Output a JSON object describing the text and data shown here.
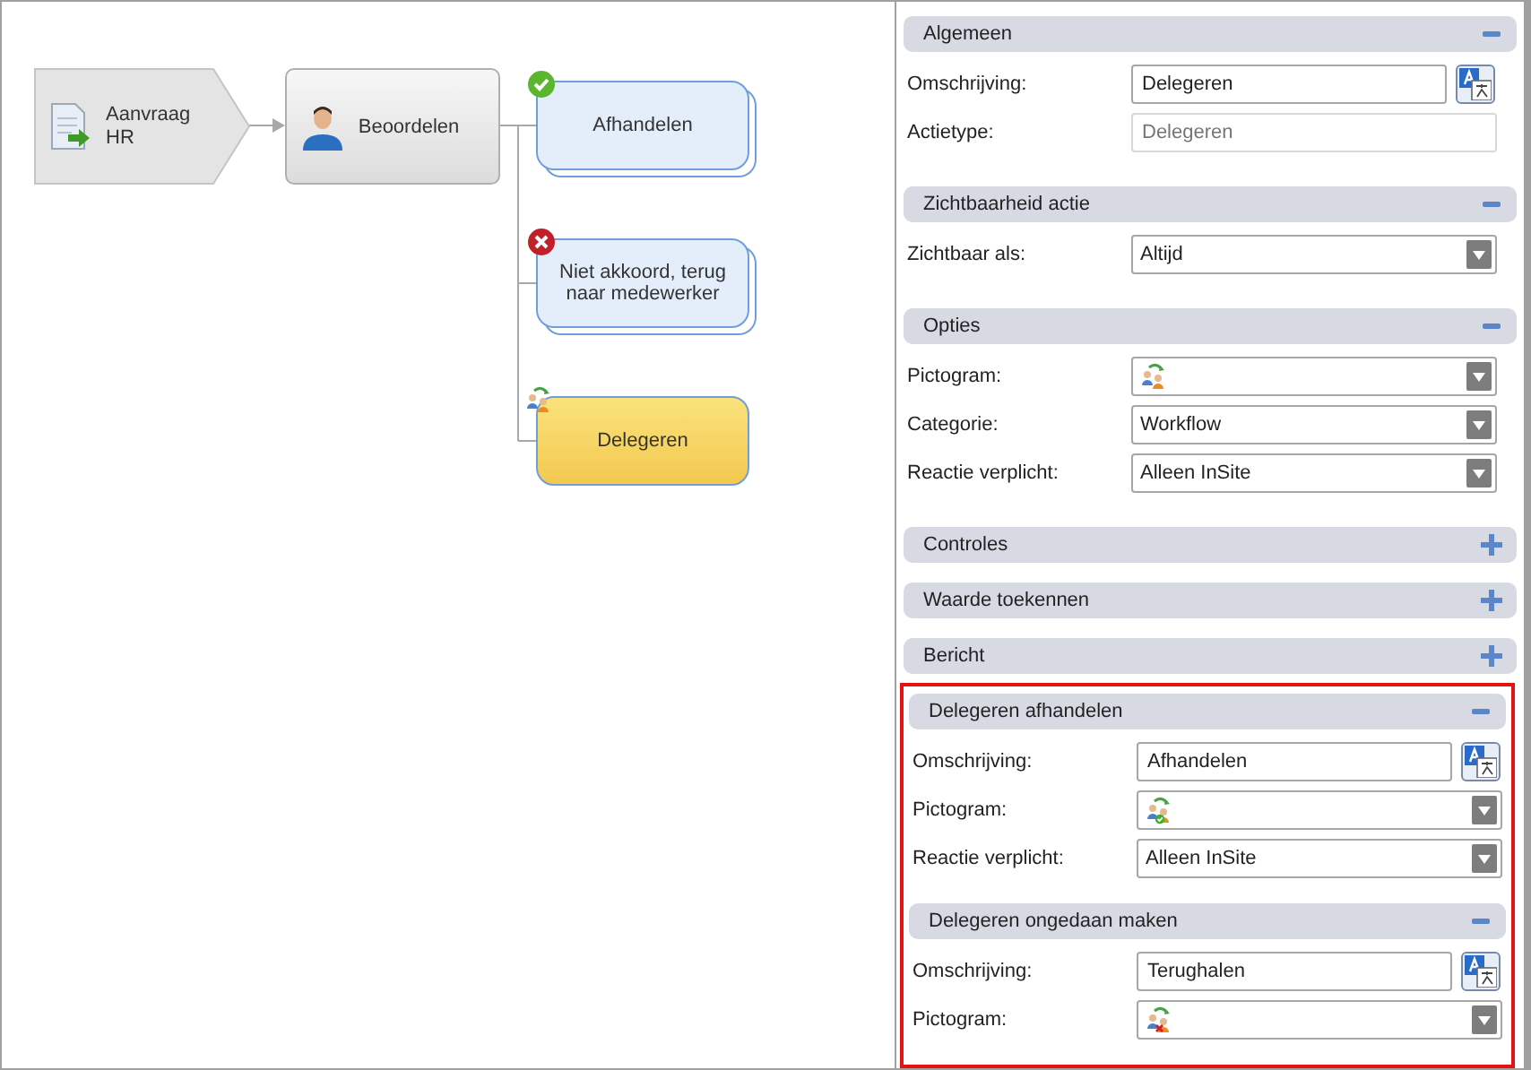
{
  "diagram": {
    "nodes": [
      {
        "kind": "start",
        "text": "Aanvraag HR"
      },
      {
        "kind": "task",
        "text": "Beoordelen"
      },
      {
        "kind": "outcome",
        "text": "Afhandelen",
        "badge": {
          "kind": "check"
        },
        "selected": false
      },
      {
        "kind": "outcome",
        "text": "Niet akkoord, terug naar medewerker",
        "badge": {
          "kind": "cross"
        },
        "selected": false
      },
      {
        "kind": "outcome",
        "text": "Delegeren",
        "badge": {
          "kind": "delegate"
        },
        "selected": true
      }
    ]
  },
  "panel": {
    "sections": [
      {
        "title": "Algemeen",
        "expanded": true,
        "fields": [
          {
            "label": "Omschrijving:",
            "kind": "text",
            "value": "Delegeren",
            "translate": true
          },
          {
            "label": "Actietype:",
            "kind": "text",
            "placeholder": "Delegeren",
            "disabled": true
          }
        ]
      },
      {
        "title": "Zichtbaarheid actie",
        "expanded": true,
        "fields": [
          {
            "label": "Zichtbaar als:",
            "kind": "select",
            "value": "Altijd"
          }
        ]
      },
      {
        "title": "Opties",
        "expanded": true,
        "fields": [
          {
            "label": "Pictogram:",
            "kind": "icon-select",
            "icon": {
              "kind": "plain"
            }
          },
          {
            "label": "Categorie:",
            "kind": "select",
            "value": "Workflow"
          },
          {
            "label": "Reactie verplicht:",
            "kind": "select",
            "value": "Alleen InSite"
          }
        ]
      },
      {
        "title": "Controles",
        "expanded": false
      },
      {
        "title": "Waarde toekennen",
        "expanded": false
      },
      {
        "title": "Bericht",
        "expanded": false
      }
    ],
    "highlight_group": {
      "sections": [
        {
          "title": "Delegeren afhandelen",
          "expanded": true,
          "fields": [
            {
              "label": "Omschrijving:",
              "kind": "text",
              "value": "Afhandelen",
              "translate": true
            },
            {
              "label": "Pictogram:",
              "kind": "icon-select",
              "icon": {
                "kind": "check"
              }
            },
            {
              "label": "Reactie verplicht:",
              "kind": "select",
              "value": "Alleen InSite"
            }
          ]
        },
        {
          "title": "Delegeren ongedaan maken",
          "expanded": true,
          "fields": [
            {
              "label": "Omschrijving:",
              "kind": "text",
              "value": "Terughalen",
              "translate": true
            },
            {
              "label": "Pictogram:",
              "kind": "icon-select",
              "icon": {
                "kind": "cross"
              }
            }
          ]
        }
      ]
    }
  }
}
